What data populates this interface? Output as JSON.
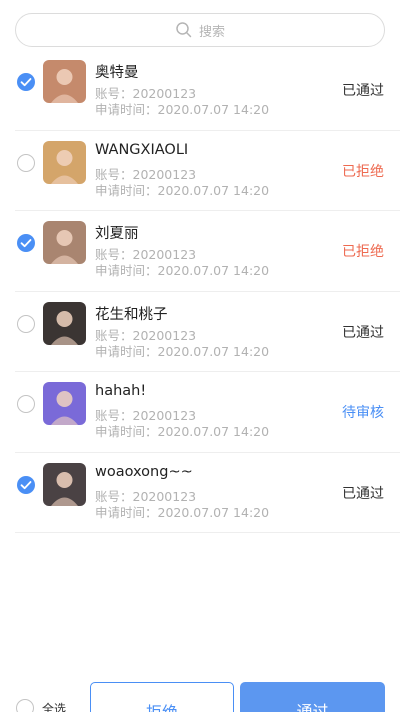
{
  "search": {
    "placeholder": "搜索"
  },
  "applicants": [
    {
      "name": "奥特曼",
      "account": "账号：20200123",
      "apply_time": "申请时间：2020.07.07  14:20",
      "status": "已通过",
      "status_kind": "approved",
      "checked": true,
      "avatar_color": "#c58a6c"
    },
    {
      "name": "WANGXIAOLI",
      "account": "账号：20200123",
      "apply_time": "申请时间：2020.07.07  14:20",
      "status": "已拒绝",
      "status_kind": "rejected",
      "checked": false,
      "avatar_color": "#d4a56a"
    },
    {
      "name": "刘夏丽",
      "account": "账号：20200123",
      "apply_time": "申请时间：2020.07.07  14:20",
      "status": "已拒绝",
      "status_kind": "rejected",
      "checked": true,
      "avatar_color": "#a98570"
    },
    {
      "name": "花生和桃子",
      "account": "账号：20200123",
      "apply_time": "申请时间：2020.07.07  14:20",
      "status": "已通过",
      "status_kind": "approved",
      "checked": false,
      "avatar_color": "#3b3533"
    },
    {
      "name": "hahah!",
      "account": "账号：20200123",
      "apply_time": "申请时间：2020.07.07  14:20",
      "status": "待审核",
      "status_kind": "pending",
      "checked": false,
      "avatar_color": "#7a6ad8"
    },
    {
      "name": "woaoxong~~",
      "account": "账号：20200123",
      "apply_time": "申请时间：2020.07.07  14:20",
      "status": "已通过",
      "status_kind": "approved",
      "checked": true,
      "avatar_color": "#4a4244"
    }
  ],
  "footer": {
    "select_all_label": "全选",
    "reject_label": "拒绝",
    "approve_label": "通过"
  },
  "colors": {
    "accent": "#4a8ff5",
    "rejected": "#ee6a50",
    "approve_button": "#5c97f0"
  },
  "icons": {
    "search": "search-icon",
    "check": "checkmark-icon"
  }
}
